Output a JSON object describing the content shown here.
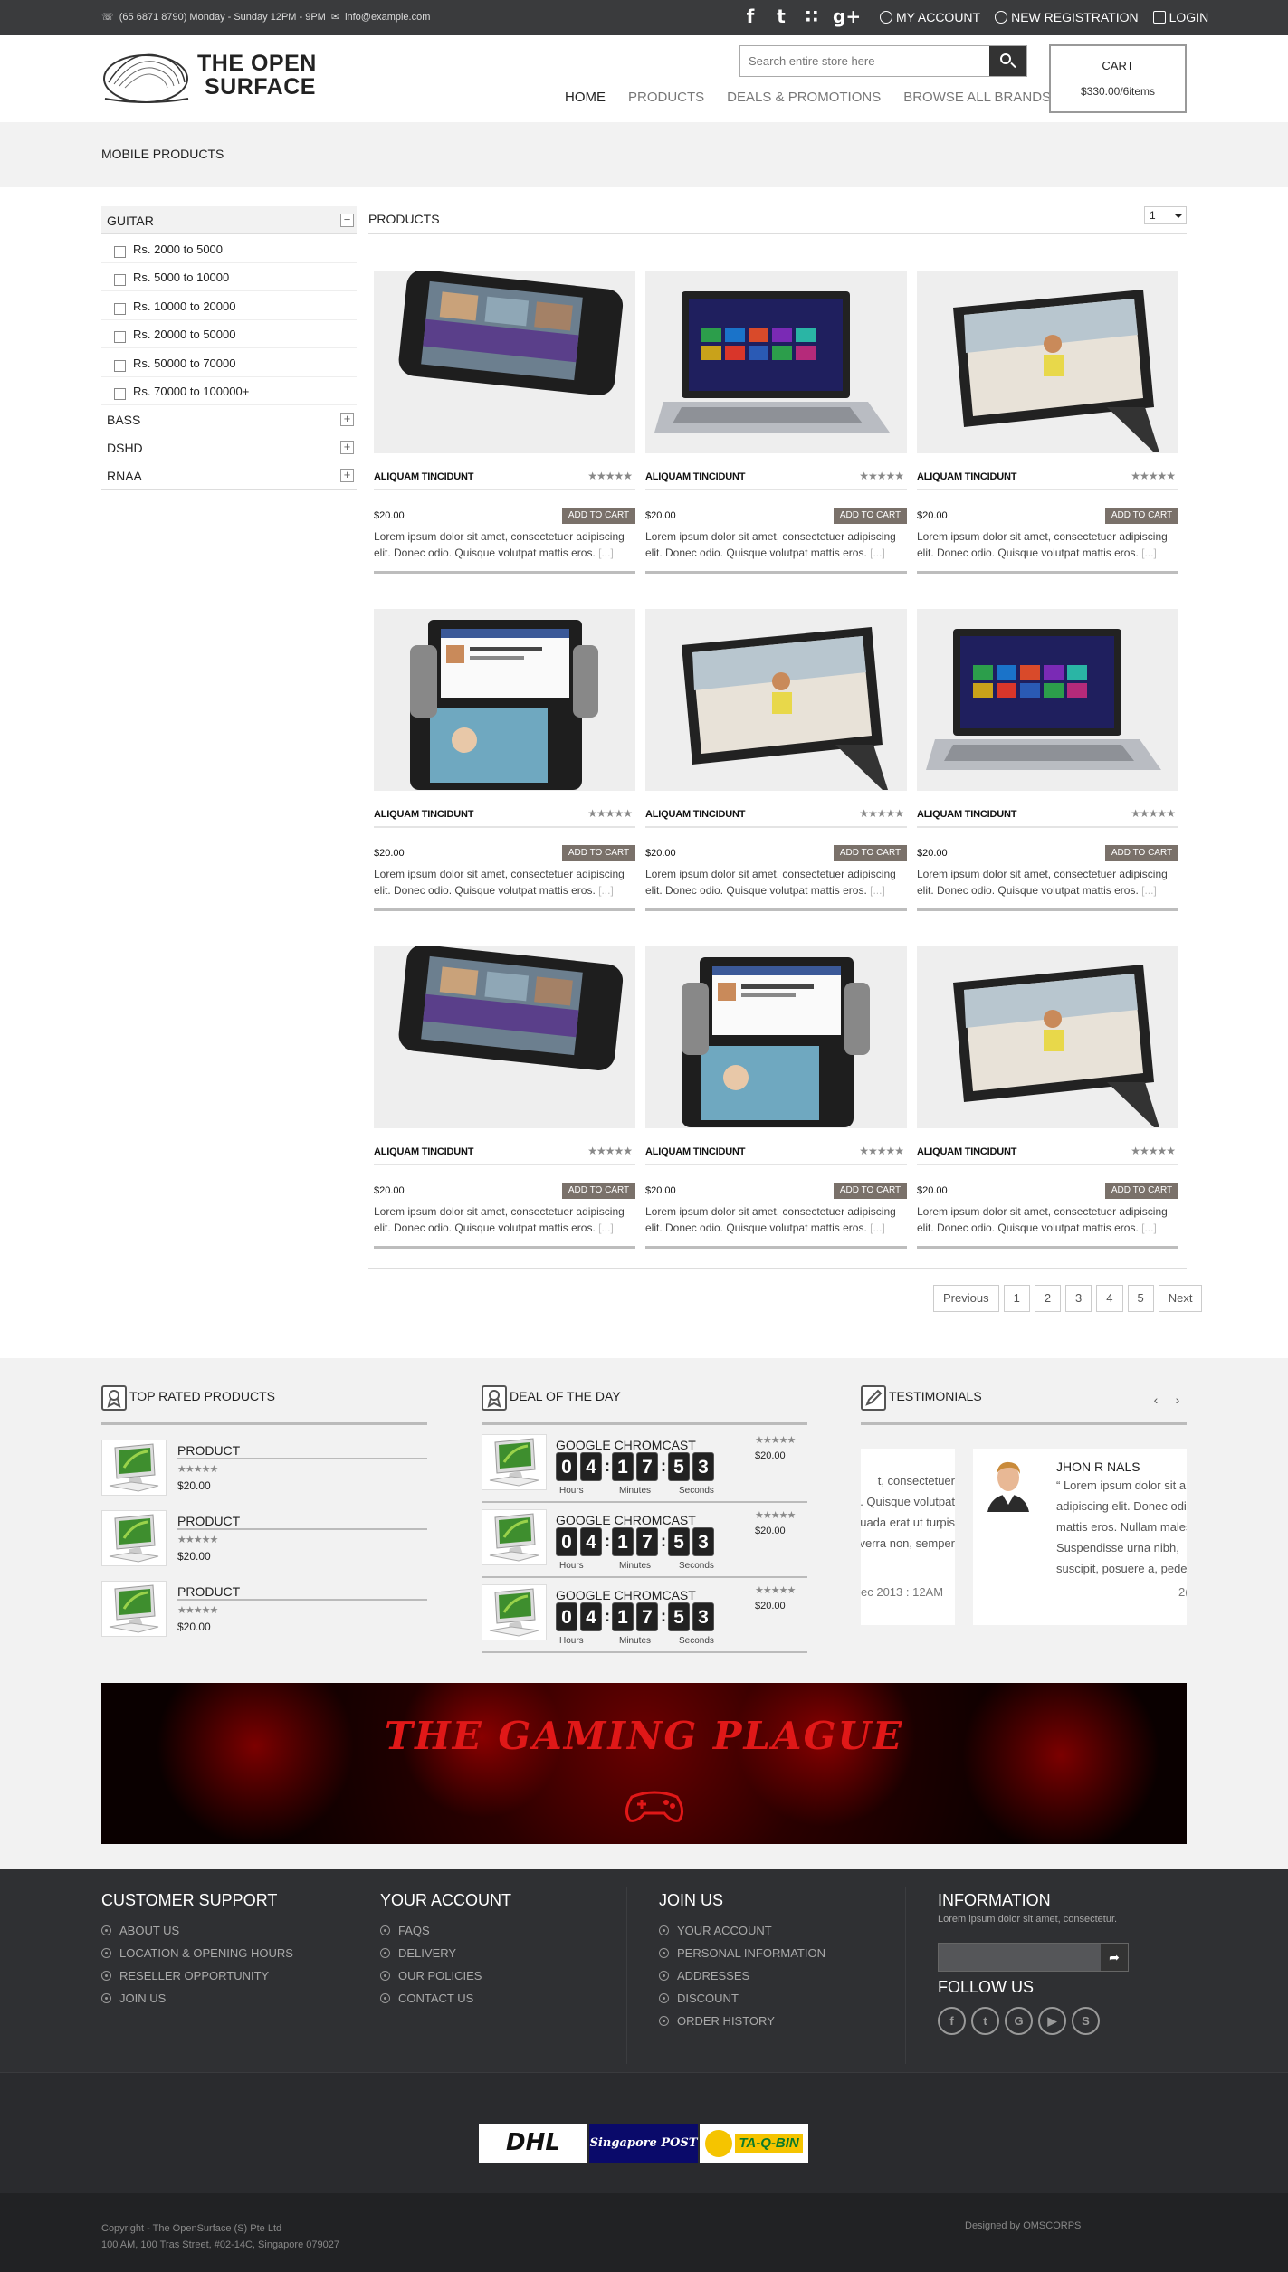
{
  "topbar": {
    "contact_phone": "(65 6871 8790) Monday - Sunday 12PM - 9PM",
    "contact_email": "info@example.com",
    "social": [
      {
        "icon": "facebook-icon",
        "glyph": "f"
      },
      {
        "icon": "twitter-icon",
        "glyph": "t"
      },
      {
        "icon": "rss-icon",
        "glyph": "∷"
      },
      {
        "icon": "googleplus-icon",
        "glyph": "g+"
      }
    ],
    "links": [
      "MY ACCOUNT",
      "NEW REGISTRATION",
      "LOGIN"
    ]
  },
  "header": {
    "logo_line1": "THE OPEN",
    "logo_line2": "SURFACE",
    "search_placeholder": "Search entire store here",
    "nav": [
      "HOME",
      "PRODUCTS",
      "DEALS & PROMOTIONS",
      "BROWSE ALL BRANDS"
    ],
    "cart_title": "CART",
    "cart_value": "$330.00/6items"
  },
  "page_title": "MOBILE PRODUCTS",
  "sidebar": {
    "open_category": "GUITAR",
    "open_toggle": "−",
    "options": [
      "Rs. 2000 to 5000",
      "Rs. 5000 to 10000",
      "Rs. 10000 to 20000",
      "Rs. 20000 to 50000",
      "Rs. 50000 to 70000",
      "Rs. 70000 to 100000+"
    ],
    "categories": [
      "BASS",
      "DSHD",
      "RNAA"
    ],
    "closed_toggle": "+"
  },
  "products": {
    "heading": "PRODUCTS",
    "per_page": "1",
    "items": [
      {
        "name": "ALIQUAM TINCIDUNT",
        "price": "$20.00",
        "cta": "ADD TO CART",
        "stars": "★★★★★",
        "desc": "Lorem ipsum dolor sit amet, consectetuer adipiscing elit. Donec odio. Quisque volutpat mattis eros.",
        "more": "[...]",
        "img": "phone"
      },
      {
        "name": "ALIQUAM TINCIDUNT",
        "price": "$20.00",
        "cta": "ADD TO CART",
        "stars": "★★★★★",
        "desc": "Lorem ipsum dolor sit amet, consectetuer adipiscing elit. Donec odio. Quisque volutpat mattis eros.",
        "more": "[...]",
        "img": "laptop"
      },
      {
        "name": "ALIQUAM TINCIDUNT",
        "price": "$20.00",
        "cta": "ADD TO CART",
        "stars": "★★★★★",
        "desc": "Lorem ipsum dolor sit amet, consectetuer adipiscing elit. Donec odio. Quisque volutpat mattis eros.",
        "more": "[...]",
        "img": "tablet"
      },
      {
        "name": "ALIQUAM TINCIDUNT",
        "price": "$20.00",
        "cta": "ADD TO CART",
        "stars": "★★★★★",
        "desc": "Lorem ipsum dolor sit amet, consectetuer adipiscing elit. Donec odio. Quisque volutpat mattis eros.",
        "more": "[...]",
        "img": "dual"
      },
      {
        "name": "ALIQUAM TINCIDUNT",
        "price": "$20.00",
        "cta": "ADD TO CART",
        "stars": "★★★★★",
        "desc": "Lorem ipsum dolor sit amet, consectetuer adipiscing elit. Donec odio. Quisque volutpat mattis eros.",
        "more": "[...]",
        "img": "tablet"
      },
      {
        "name": "ALIQUAM TINCIDUNT",
        "price": "$20.00",
        "cta": "ADD TO CART",
        "stars": "★★★★★",
        "desc": "Lorem ipsum dolor sit amet, consectetuer adipiscing elit. Donec odio. Quisque volutpat mattis eros.",
        "more": "[...]",
        "img": "laptop"
      },
      {
        "name": "ALIQUAM TINCIDUNT",
        "price": "$20.00",
        "cta": "ADD TO CART",
        "stars": "★★★★★",
        "desc": "Lorem ipsum dolor sit amet, consectetuer adipiscing elit. Donec odio. Quisque volutpat mattis eros.",
        "more": "[...]",
        "img": "phone"
      },
      {
        "name": "ALIQUAM TINCIDUNT",
        "price": "$20.00",
        "cta": "ADD TO CART",
        "stars": "★★★★★",
        "desc": "Lorem ipsum dolor sit amet, consectetuer adipiscing elit. Donec odio. Quisque volutpat mattis eros.",
        "more": "[...]",
        "img": "dual"
      },
      {
        "name": "ALIQUAM TINCIDUNT",
        "price": "$20.00",
        "cta": "ADD TO CART",
        "stars": "★★★★★",
        "desc": "Lorem ipsum dolor sit amet, consectetuer adipiscing elit. Donec odio. Quisque volutpat mattis eros.",
        "more": "[...]",
        "img": "tablet"
      }
    ]
  },
  "pagination": [
    "Previous",
    "1",
    "2",
    "3",
    "4",
    "5",
    "Next"
  ],
  "top_rated": {
    "title": "TOP RATED PRODUCTS",
    "items": [
      {
        "name": "PRODUCT",
        "stars": "★★★★★",
        "price": "$20.00"
      },
      {
        "name": "PRODUCT",
        "stars": "★★★★★",
        "price": "$20.00"
      },
      {
        "name": "PRODUCT",
        "stars": "★★★★★",
        "price": "$20.00"
      }
    ]
  },
  "deal_of_day": {
    "title": "DEAL OF THE DAY",
    "countdown_labels": [
      "Hours",
      "Minutes",
      "Seconds"
    ],
    "items": [
      {
        "name": "GOOGLE CHROMCAST",
        "stars": "★★★★★",
        "price": "$20.00",
        "digits": [
          "0",
          "4",
          "1",
          "7",
          "5",
          "3"
        ]
      },
      {
        "name": "GOOGLE CHROMCAST",
        "stars": "★★★★★",
        "price": "$20.00",
        "digits": [
          "0",
          "4",
          "1",
          "7",
          "5",
          "3"
        ]
      },
      {
        "name": "GOOGLE CHROMCAST",
        "stars": "★★★★★",
        "price": "$20.00",
        "digits": [
          "0",
          "4",
          "1",
          "7",
          "5",
          "3"
        ]
      }
    ]
  },
  "testimonials": {
    "title": "TESTIMONIALS",
    "prev": "‹",
    "next": "›",
    "left_partial": [
      "t, consectetuer",
      "adipiscing elit. Donec odio. Quisque volutpat",
      "mattis eros. Nullam malesuada erat ut turpis.",
      "Suspendisse urna nibh, viverra non, semper"
    ],
    "left_date": "ec 2013 : 12AM",
    "name": "JHON R NALS",
    "quote_lines": [
      "Lorem ipsum dolor sit a",
      "adipiscing elit. Donec odio.",
      "mattis eros. Nullam males",
      "Suspendisse urna nibh,",
      "suscipit, posuere a, pede. -"
    ],
    "right_date": "2("
  },
  "banner": {
    "title": "THE GAMING PLAGUE"
  },
  "footer": {
    "customer_support": {
      "title": "CUSTOMER SUPPORT",
      "items": [
        "ABOUT US",
        "LOCATION & OPENING HOURS",
        "RESELLER OPPORTUNITY",
        "JOIN US"
      ]
    },
    "your_account": {
      "title": "YOUR ACCOUNT",
      "items": [
        "FAQS",
        "DELIVERY",
        "OUR POLICIES",
        "CONTACT US"
      ]
    },
    "join_us": {
      "title": "JOIN US",
      "items": [
        "YOUR ACCOUNT",
        "PERSONAL INFORMATION",
        "ADDRESSES",
        "DISCOUNT",
        "ORDER HISTORY"
      ]
    },
    "information": {
      "title": "INFORMATION",
      "text": "Lorem ipsum dolor sit amet, consectetur.",
      "follow": "FOLLOW US",
      "social": [
        {
          "icon": "facebook-icon",
          "glyph": "f"
        },
        {
          "icon": "twitter-icon",
          "glyph": "t"
        },
        {
          "icon": "google-icon",
          "glyph": "G"
        },
        {
          "icon": "youtube-icon",
          "glyph": "▶"
        },
        {
          "icon": "skype-icon",
          "glyph": "S"
        }
      ]
    }
  },
  "shipping_logos": [
    "DHL",
    "Singapore POST",
    "TA-Q-BIN"
  ],
  "copyright": {
    "line1": "Copyright - The OpenSurface (S) Pte Ltd",
    "line2": "100 AM, 100 Tras Street, #02-14C, Singapore 079027"
  },
  "designed_by": "Designed by OMSCORPS",
  "colors": {
    "topbar": "#3a3b3d",
    "footer": "#2f3033",
    "accent_button": "#7a716a",
    "banner": "#e01818"
  }
}
